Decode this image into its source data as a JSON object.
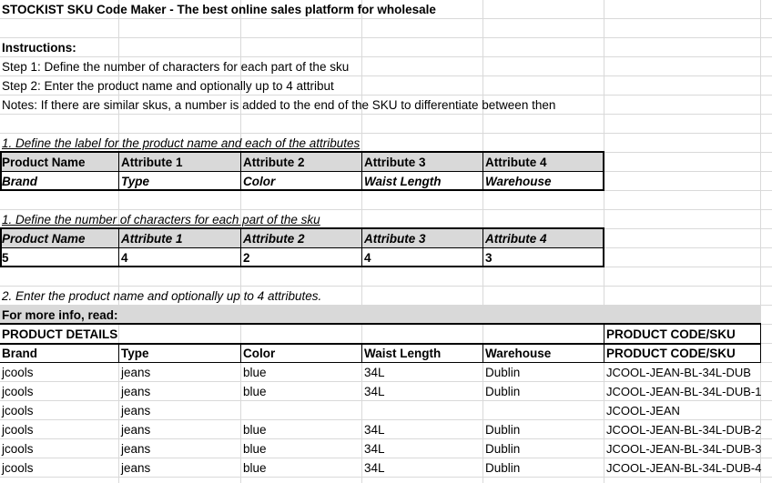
{
  "title": "STOCKIST SKU Code Maker - The best online sales platform for wholesale",
  "instructions": {
    "heading": "Instructions:",
    "step1": "Step 1: Define the number of characters for each part of the sku",
    "step2": "Step 2: Enter the product name and optionally up to 4 attribut",
    "notes": "Notes: If there are similar skus, a number is added to the end of the SKU to differentiate between then"
  },
  "labels_section": {
    "heading": "1. Define the label for the product name and each of the attributes",
    "headers": [
      "Product Name",
      "Attribute 1",
      "Attribute 2",
      "Attribute 3",
      "Attribute 4"
    ],
    "values": [
      "Brand",
      "Type",
      "Color",
      "Waist Length",
      "Warehouse"
    ]
  },
  "chars_section": {
    "heading": "1. Define the number of characters for each part of the sku",
    "headers": [
      "Product Name",
      "Attribute 1",
      "Attribute 2",
      "Attribute 3",
      "Attribute 4"
    ],
    "values": [
      "5",
      "4",
      "2",
      "4",
      "3"
    ]
  },
  "entry_section": {
    "heading": "2. Enter the product name and optionally up to 4 attributes.",
    "more_info": "For more info, read:",
    "details_label": "PRODUCT  DETAILS",
    "code_label": "PRODUCT CODE/SKU",
    "columns": [
      "Brand",
      "Type",
      "Color",
      "Waist Length",
      "Warehouse",
      "PRODUCT CODE/SKU"
    ],
    "rows": [
      [
        "jcools",
        "jeans",
        "blue",
        "34L",
        "Dublin",
        "JCOOL-JEAN-BL-34L-DUB"
      ],
      [
        "jcools",
        "jeans",
        "blue",
        "34L",
        "Dublin",
        "JCOOL-JEAN-BL-34L-DUB-1"
      ],
      [
        "jcools",
        "jeans",
        "",
        "",
        "",
        "JCOOL-JEAN"
      ],
      [
        "jcools",
        "jeans",
        "blue",
        "34L",
        "Dublin",
        "JCOOL-JEAN-BL-34L-DUB-2"
      ],
      [
        "jcools",
        "jeans",
        "blue",
        "34L",
        "Dublin",
        "JCOOL-JEAN-BL-34L-DUB-3"
      ],
      [
        "jcools",
        "jeans",
        "blue",
        "34L",
        "Dublin",
        "JCOOL-JEAN-BL-34L-DUB-4"
      ]
    ]
  },
  "colors": {
    "header_fill": "#d9d9d9",
    "gridline": "#d9d9d9"
  }
}
